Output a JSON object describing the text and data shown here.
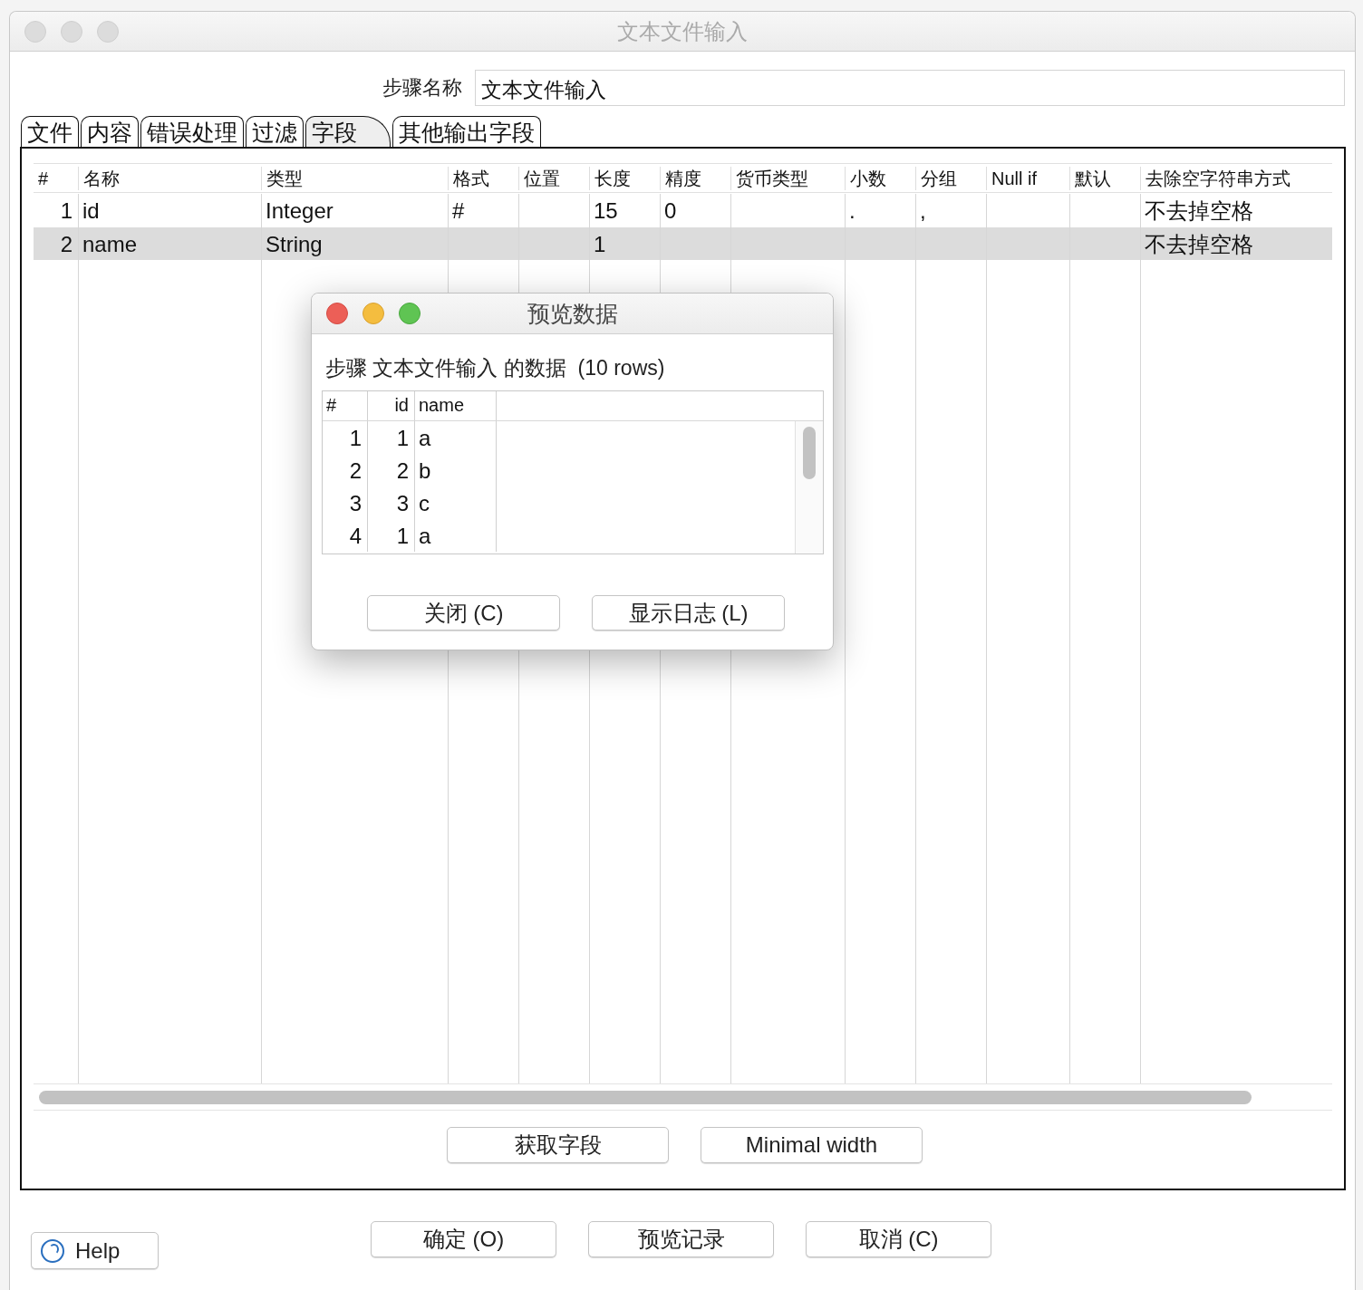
{
  "window": {
    "title": "文本文件输入"
  },
  "step_name": {
    "label": "步骤名称",
    "value": "文本文件输入"
  },
  "tabs": [
    {
      "label": "文件",
      "selected": false
    },
    {
      "label": "内容",
      "selected": false
    },
    {
      "label": "错误处理",
      "selected": false
    },
    {
      "label": "过滤",
      "selected": false
    },
    {
      "label": "字段",
      "selected": true
    },
    {
      "label": "其他输出字段",
      "selected": false
    }
  ],
  "fields_table": {
    "columns": [
      "#",
      "名称",
      "类型",
      "格式",
      "位置",
      "长度",
      "精度",
      "货币类型",
      "小数",
      "分组",
      "Null if",
      "默认",
      "去除空字符串方式"
    ],
    "rows": [
      {
        "cells": [
          "1",
          "id",
          "Integer",
          "#",
          null,
          "15",
          "0",
          null,
          ".",
          ",",
          null,
          null,
          "不去掉空格"
        ],
        "selected": false
      },
      {
        "cells": [
          "2",
          "name",
          "String",
          null,
          null,
          "1",
          null,
          null,
          null,
          null,
          null,
          null,
          "不去掉空格"
        ],
        "selected": true
      }
    ]
  },
  "panel_buttons": [
    "获取字段",
    "Minimal width"
  ],
  "help_button": "Help",
  "buttons": [
    "确定 (O)",
    "预览记录",
    "取消 (C)"
  ],
  "dialog": {
    "title": "预览数据",
    "caption": "步骤 文本文件输入 的数据  (10 rows)",
    "columns": [
      "#",
      "id",
      "name"
    ],
    "rows": [
      [
        "1",
        "1",
        "a"
      ],
      [
        "2",
        "2",
        "b"
      ],
      [
        "3",
        "3",
        "c"
      ],
      [
        "4",
        "1",
        "a"
      ]
    ],
    "buttons": [
      "关闭 (C)",
      "显示日志 (L)"
    ]
  }
}
